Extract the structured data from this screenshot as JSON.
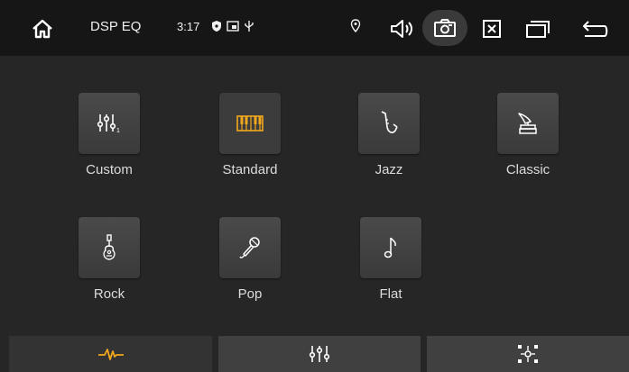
{
  "status_bar": {
    "title": "DSP EQ",
    "time": "3:17",
    "icons": [
      "home-icon",
      "shield-icon",
      "cast-icon",
      "usb-icon",
      "location-icon",
      "volume-icon",
      "screenshot-icon",
      "close-app-icon",
      "recent-apps-icon",
      "back-icon"
    ]
  },
  "presets": [
    {
      "label": "Custom",
      "icon": "sliders-icon"
    },
    {
      "label": "Standard",
      "icon": "piano-icon",
      "selected": true
    },
    {
      "label": "Jazz",
      "icon": "saxophone-icon"
    },
    {
      "label": "Classic",
      "icon": "gramophone-icon"
    },
    {
      "label": "Rock",
      "icon": "guitar-icon"
    },
    {
      "label": "Pop",
      "icon": "microphone-icon"
    },
    {
      "label": "Flat",
      "icon": "music-note-icon"
    }
  ],
  "tabs": [
    {
      "name": "eq-waveform-tab",
      "icon": "waveform-icon",
      "selected": true
    },
    {
      "name": "eq-sliders-tab",
      "icon": "sliders-icon"
    },
    {
      "name": "sound-field-tab",
      "icon": "speaker-position-icon"
    }
  ],
  "colors": {
    "accent": "#f2a81d",
    "background": "#262626",
    "statusbar": "#161616"
  }
}
